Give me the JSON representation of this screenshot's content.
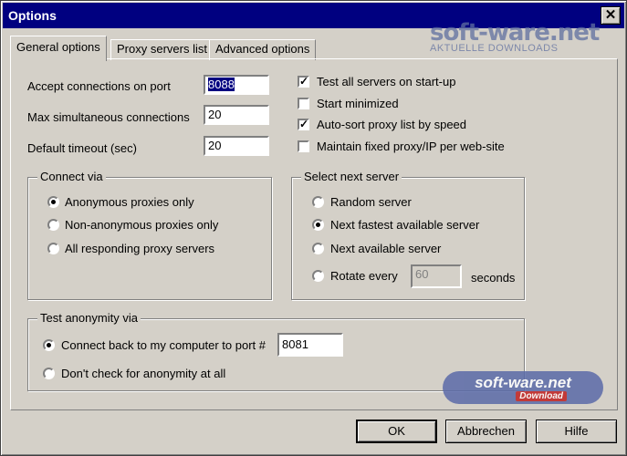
{
  "window": {
    "title": "Options",
    "close_symbol": "✕"
  },
  "tabs": [
    {
      "label": "General options"
    },
    {
      "label": "Proxy servers list"
    },
    {
      "label": "Advanced options"
    }
  ],
  "fields": {
    "accept_label": "Accept connections on port",
    "accept_value": "8088",
    "max_label": "Max simultaneous connections",
    "max_value": "20",
    "timeout_label": "Default timeout (sec)",
    "timeout_value": "20"
  },
  "checkboxes": [
    {
      "label": "Test all servers on start-up",
      "checked": true
    },
    {
      "label": "Start minimized",
      "checked": false
    },
    {
      "label": "Auto-sort proxy list by speed",
      "checked": true
    },
    {
      "label": "Maintain fixed proxy/IP per web-site",
      "checked": false
    }
  ],
  "connect_via": {
    "title": "Connect via",
    "options": [
      {
        "label": "Anonymous proxies only",
        "selected": true
      },
      {
        "label": "Non-anonymous proxies only",
        "selected": false
      },
      {
        "label": "All responding proxy servers",
        "selected": false
      }
    ]
  },
  "select_next": {
    "title": "Select next server",
    "options": [
      {
        "label": "Random server",
        "selected": false
      },
      {
        "label": "Next fastest available server",
        "selected": true
      },
      {
        "label": "Next available server",
        "selected": false
      },
      {
        "label": "Rotate every",
        "selected": false
      }
    ],
    "rotate_value": "60",
    "rotate_unit": "seconds"
  },
  "test_anonymity": {
    "title": "Test anonymity via",
    "connect_label": "Connect back to my computer to port #",
    "connect_selected": true,
    "port_value": "8081",
    "dont_check_label": "Don't check for anonymity at all",
    "dont_check_selected": false
  },
  "buttons": {
    "ok": "OK",
    "cancel": "Abbrechen",
    "help": "Hilfe"
  },
  "watermark": {
    "top_text": "soft-ware.net",
    "top_sub": "AKTUELLE DOWNLOADS",
    "badge_text": "soft-ware.net",
    "badge_sub": "Download"
  }
}
